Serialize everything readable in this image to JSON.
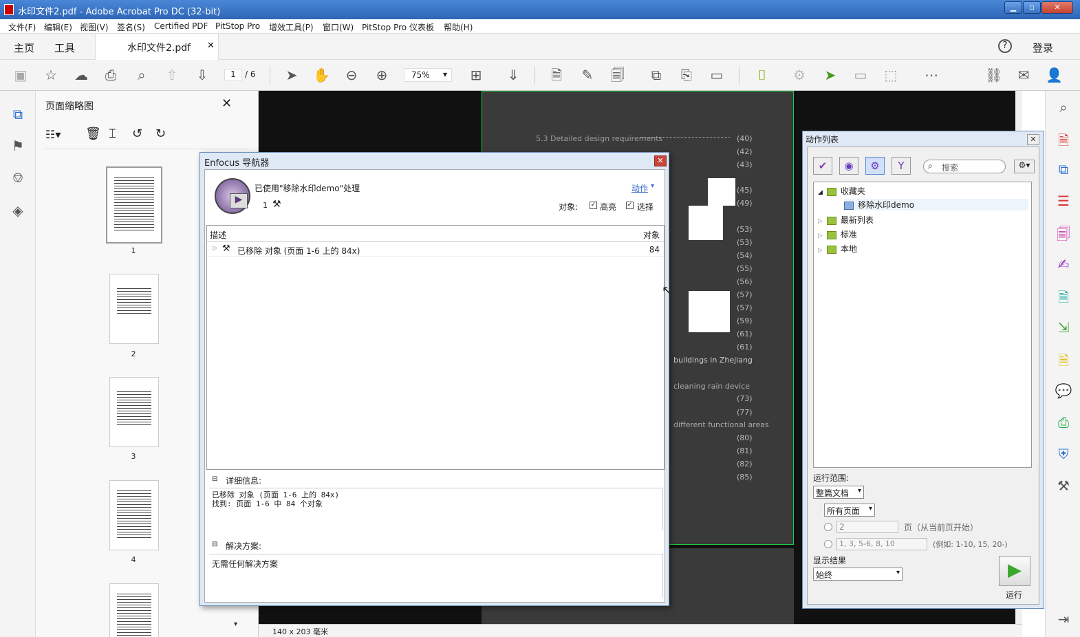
{
  "window": {
    "title": "水印文件2.pdf - Adobe Acrobat Pro DC (32-bit)"
  },
  "menu": [
    "文件(F)",
    "编辑(E)",
    "视图(V)",
    "签名(S)",
    "Certified PDF",
    "PitStop Pro",
    "增效工具(P)",
    "窗口(W)",
    "PitStop Pro 仪表板",
    "帮助(H)"
  ],
  "tabs": {
    "home": "主页",
    "tools": "工具",
    "doc": "水印文件2.pdf",
    "login": "登录"
  },
  "toolbar": {
    "page_current": "1",
    "page_total": "/ 6",
    "zoom": "75%"
  },
  "thumbs": {
    "title": "页面缩略图",
    "pages": [
      "1",
      "2",
      "3",
      "4"
    ]
  },
  "status": {
    "size": "140 x 203 毫米"
  },
  "dialog": {
    "title": "Enfocus 导航器",
    "processed": "已使用\"移除水印demo\"处理",
    "count": "1",
    "action": "动作",
    "objects_label": "对象:",
    "highlight": "高亮",
    "select": "选择",
    "col_desc": "描述",
    "col_obj": "对象",
    "row_text": "已移除 对象 (页面 1-6 上的 84x)",
    "row_count": "84",
    "detail_label": "详细信息:",
    "detail_line1": "已移除 对象 (页面 1-6 上的 84x)",
    "detail_line2": "找到: 页面 1-6 中 84 个对象",
    "solution_label": "解决方案:",
    "solution_text": "无需任何解决方案"
  },
  "actions": {
    "title": "动作列表",
    "search_placeholder": "搜索",
    "tree": [
      "收藏夹",
      "移除水印demo",
      "最新列表",
      "标准",
      "本地"
    ],
    "run_scope_label": "运行范围:",
    "scope": "整篇文档",
    "pages": "所有页面",
    "page_num": "2",
    "page_hint": "页（从当前页开始）",
    "range": "1, 3, 5-6, 8, 10",
    "range_hint": "(例如: 1-10, 15, 20-)",
    "show_result": "显示结果",
    "result": "始终",
    "run": "运行"
  },
  "doc_text": {
    "l1": "5.3    Detailed design requirements",
    "toc": [
      "(40)",
      "(42)",
      "(43)",
      "(45)",
      "(49)",
      "(53)",
      "(53)",
      "(54)",
      "(55)",
      "(56)",
      "(57)",
      "(57)",
      "(59)",
      "(61)",
      "(61)"
    ],
    "bld": "buildings in Zhejiang",
    "rain": "cleaning rain device",
    "toc2": [
      "(73)",
      "(77)"
    ],
    "func": "different functional areas",
    "toc3": [
      "(80)",
      "(81)",
      "(82)",
      "(85)"
    ]
  }
}
